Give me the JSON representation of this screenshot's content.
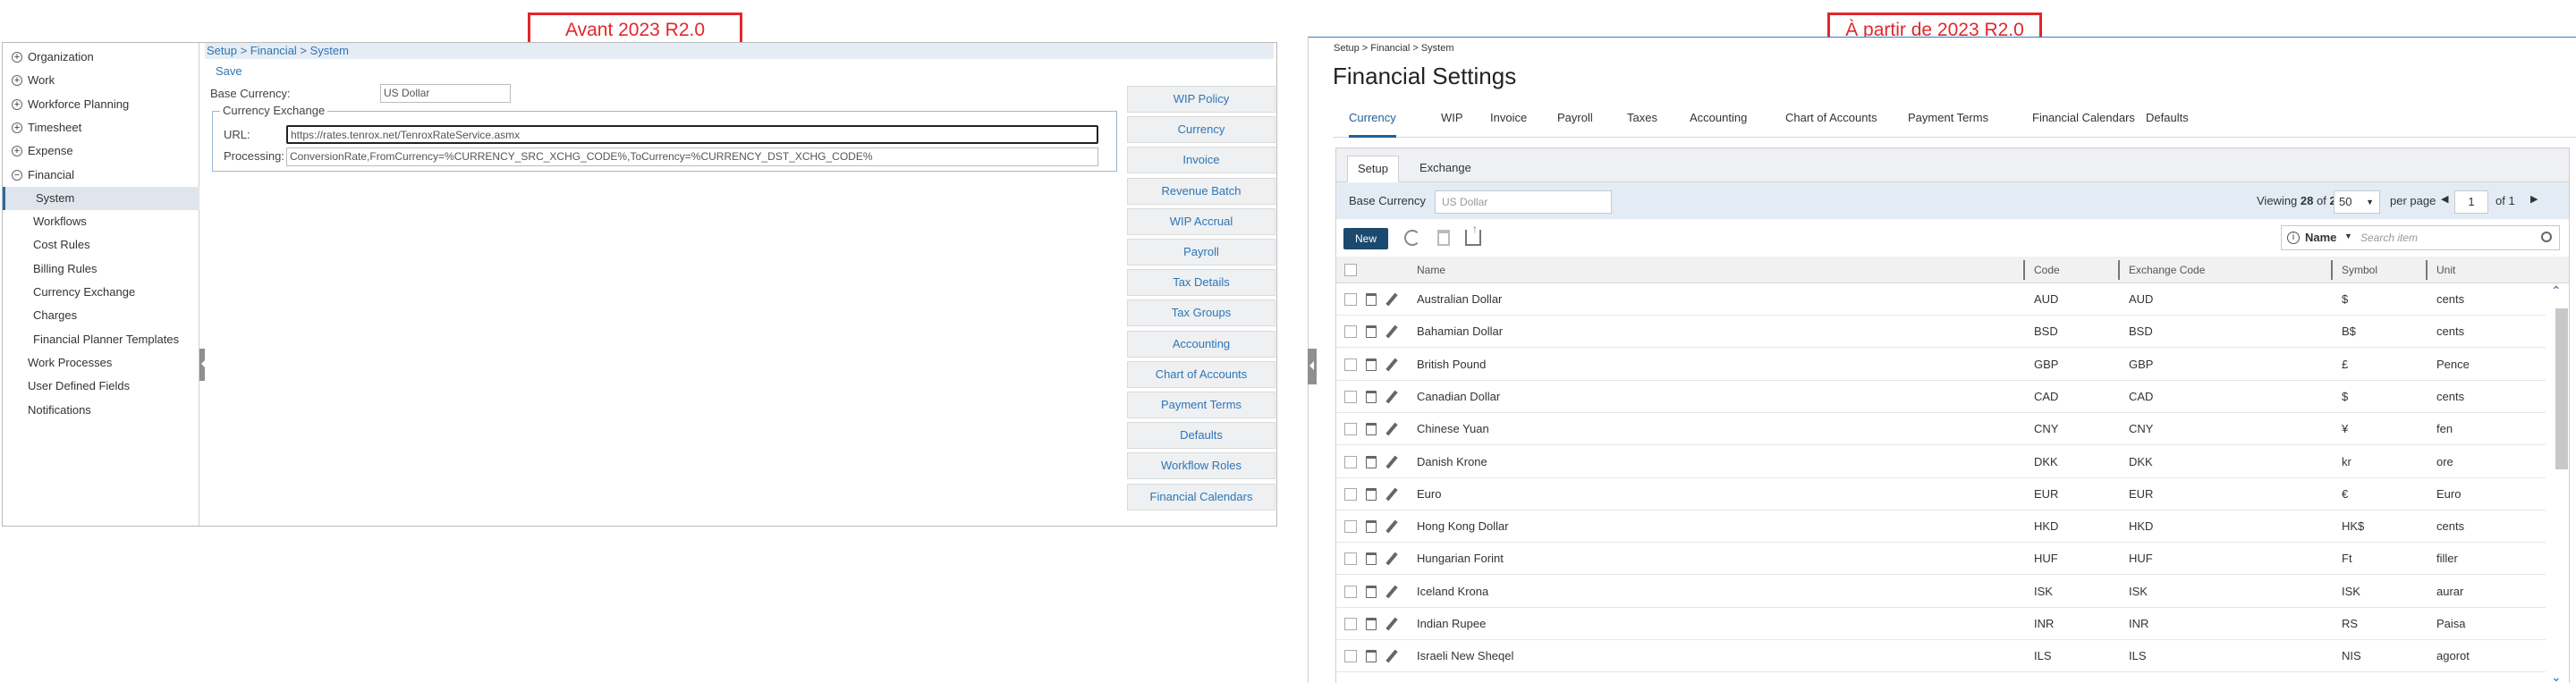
{
  "labels": {
    "before": "Avant 2023 R2.0",
    "after": "À partir de 2023 R2.0"
  },
  "old": {
    "breadcrumb": "Setup > Financial > System",
    "save": "Save",
    "base_currency_label": "Base Currency:",
    "base_currency_value": "US Dollar",
    "fieldset_legend": "Currency Exchange",
    "url_label": "URL:",
    "url_value": "https://rates.tenrox.net/TenroxRateService.asmx",
    "processing_label": "Processing:",
    "processing_value": "ConversionRate,FromCurrency=%CURRENCY_SRC_XCHG_CODE%,ToCurrency=%CURRENCY_DST_XCHG_CODE%",
    "nav": [
      {
        "label": "Organization",
        "type": "plus"
      },
      {
        "label": "Work",
        "type": "plus"
      },
      {
        "label": "Workforce Planning",
        "type": "plus"
      },
      {
        "label": "Timesheet",
        "type": "plus"
      },
      {
        "label": "Expense",
        "type": "plus"
      },
      {
        "label": "Financial",
        "type": "minus"
      },
      {
        "label": "System",
        "type": "sub",
        "selected": true
      },
      {
        "label": "Workflows",
        "type": "sub"
      },
      {
        "label": "Cost Rules",
        "type": "sub"
      },
      {
        "label": "Billing Rules",
        "type": "sub"
      },
      {
        "label": "Currency Exchange",
        "type": "sub"
      },
      {
        "label": "Charges",
        "type": "sub"
      },
      {
        "label": "Financial Planner Templates",
        "type": "sub"
      },
      {
        "label": "Work Processes",
        "type": "plain"
      },
      {
        "label": "User Defined Fields",
        "type": "plain"
      },
      {
        "label": "Notifications",
        "type": "plain"
      }
    ],
    "buttons": [
      "WIP Policy",
      "Currency",
      "Invoice",
      "Revenue Batch",
      "WIP Accrual",
      "Payroll",
      "Tax Details",
      "Tax Groups",
      "Accounting",
      "Chart of Accounts",
      "Payment Terms",
      "Defaults",
      "Workflow Roles",
      "Financial Calendars"
    ]
  },
  "new": {
    "breadcrumb": "Setup > Financial > System",
    "title": "Financial Settings",
    "tabs": [
      "Currency",
      "WIP",
      "Invoice",
      "Payroll",
      "Taxes",
      "Accounting",
      "Chart of Accounts",
      "Payment Terms",
      "Financial Calendars",
      "Defaults"
    ],
    "subtabs": [
      "Setup",
      "Exchange"
    ],
    "base_currency_label": "Base Currency",
    "base_currency_placeholder": "US Dollar",
    "viewing_prefix": "Viewing",
    "viewing_count": "28",
    "viewing_of": "of",
    "viewing_total": "28",
    "per_page_value": "50",
    "per_page_label": "per page",
    "page_value": "1",
    "page_of": "of 1",
    "new_button": "New",
    "search_field": "Name",
    "search_placeholder": "Search item",
    "columns": [
      "Name",
      "Code",
      "Exchange Code",
      "Symbol",
      "Unit"
    ],
    "rows": [
      [
        "Australian Dollar",
        "AUD",
        "AUD",
        "$",
        "cents"
      ],
      [
        "Bahamian Dollar",
        "BSD",
        "BSD",
        "B$",
        "cents"
      ],
      [
        "British Pound",
        "GBP",
        "GBP",
        "£",
        "Pence"
      ],
      [
        "Canadian Dollar",
        "CAD",
        "CAD",
        "$",
        "cents"
      ],
      [
        "Chinese Yuan",
        "CNY",
        "CNY",
        "¥",
        "fen"
      ],
      [
        "Danish Krone",
        "DKK",
        "DKK",
        "kr",
        "ore"
      ],
      [
        "Euro",
        "EUR",
        "EUR",
        "€",
        "Euro"
      ],
      [
        "Hong Kong Dollar",
        "HKD",
        "HKD",
        "HK$",
        "cents"
      ],
      [
        "Hungarian Forint",
        "HUF",
        "HUF",
        "Ft",
        "filler"
      ],
      [
        "Iceland Krona",
        "ISK",
        "ISK",
        "ISK",
        "aurar"
      ],
      [
        "Indian Rupee",
        "INR",
        "INR",
        "RS",
        "Paisa"
      ],
      [
        "Israeli New Sheqel",
        "ILS",
        "ILS",
        "NIS",
        "agorot"
      ]
    ]
  }
}
